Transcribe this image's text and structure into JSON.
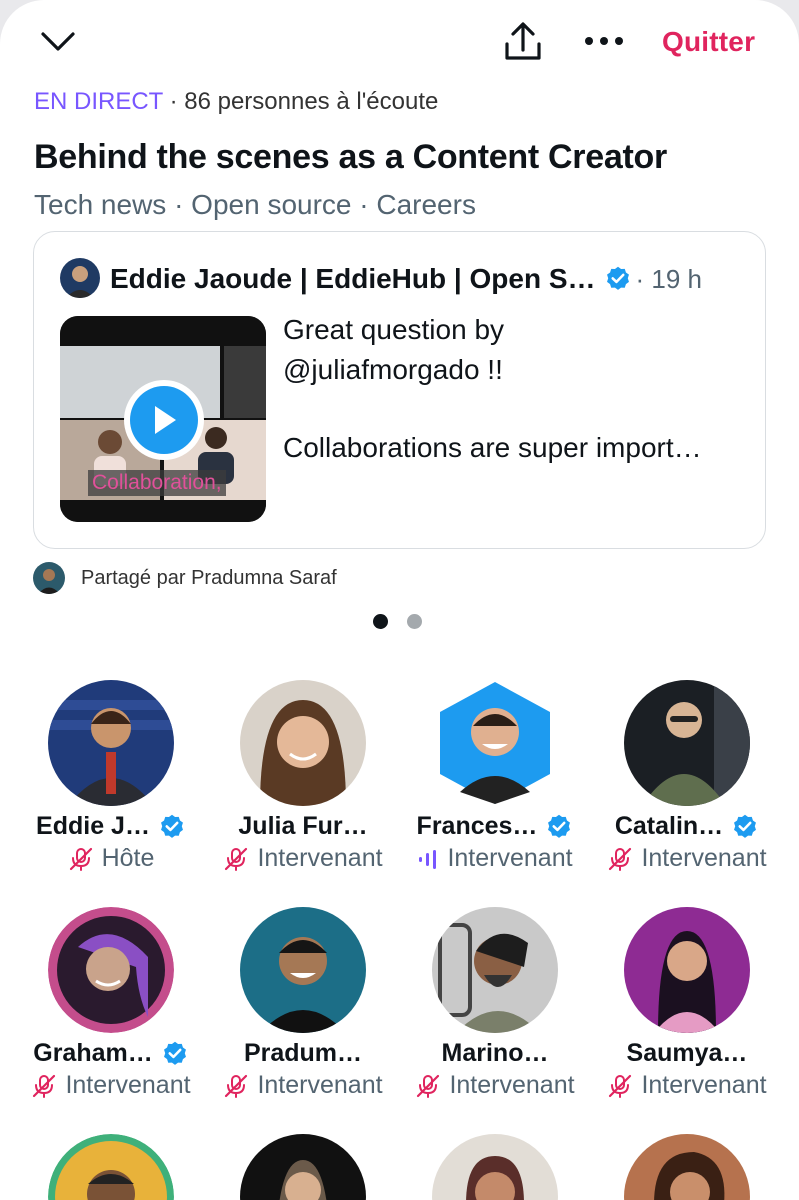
{
  "header": {
    "collapse_icon": "chevron-down-icon",
    "share_icon": "share-icon",
    "more_icon": "more-horizontal-icon",
    "quit_label": "Quitter"
  },
  "space": {
    "live_label": "EN DIRECT",
    "listeners_text": " · 86 personnes à l'écoute",
    "title": "Behind the scenes as a Content Creator",
    "topics": "Tech news · Open source · Careers"
  },
  "pinned_tweet": {
    "author": "Eddie Jaoude | EddieHub | Open S…",
    "time": "· 19 h",
    "lines": [
      "Great question by",
      "@juliafmorgado !!",
      "",
      "Collaborations are super import…"
    ],
    "video_caption": "Collaboration,",
    "shared_by": "Partagé par Pradumna Saraf"
  },
  "pagination": {
    "total": 2,
    "active": 0
  },
  "participants": [
    {
      "name": "Eddie J…",
      "verified": true,
      "role": "Hôte",
      "status": "muted"
    },
    {
      "name": "Julia Fur…",
      "verified": false,
      "role": "Intervenant",
      "status": "muted"
    },
    {
      "name": "Frances…",
      "verified": true,
      "role": "Intervenant",
      "status": "speaking"
    },
    {
      "name": "Catalin…",
      "verified": true,
      "role": "Intervenant",
      "status": "muted"
    },
    {
      "name": "Graham…",
      "verified": true,
      "role": "Intervenant",
      "status": "muted"
    },
    {
      "name": "Pradum…",
      "verified": false,
      "role": "Intervenant",
      "status": "muted"
    },
    {
      "name": "Marino…",
      "verified": false,
      "role": "Intervenant",
      "status": "muted"
    },
    {
      "name": "Saumya…",
      "verified": false,
      "role": "Intervenant",
      "status": "muted"
    }
  ],
  "colors": {
    "live": "#7856ff",
    "quit": "#e0245e",
    "verified": "#1d9bf0",
    "muted_icon": "#e0245e",
    "speaking_icon": "#7856ff"
  }
}
